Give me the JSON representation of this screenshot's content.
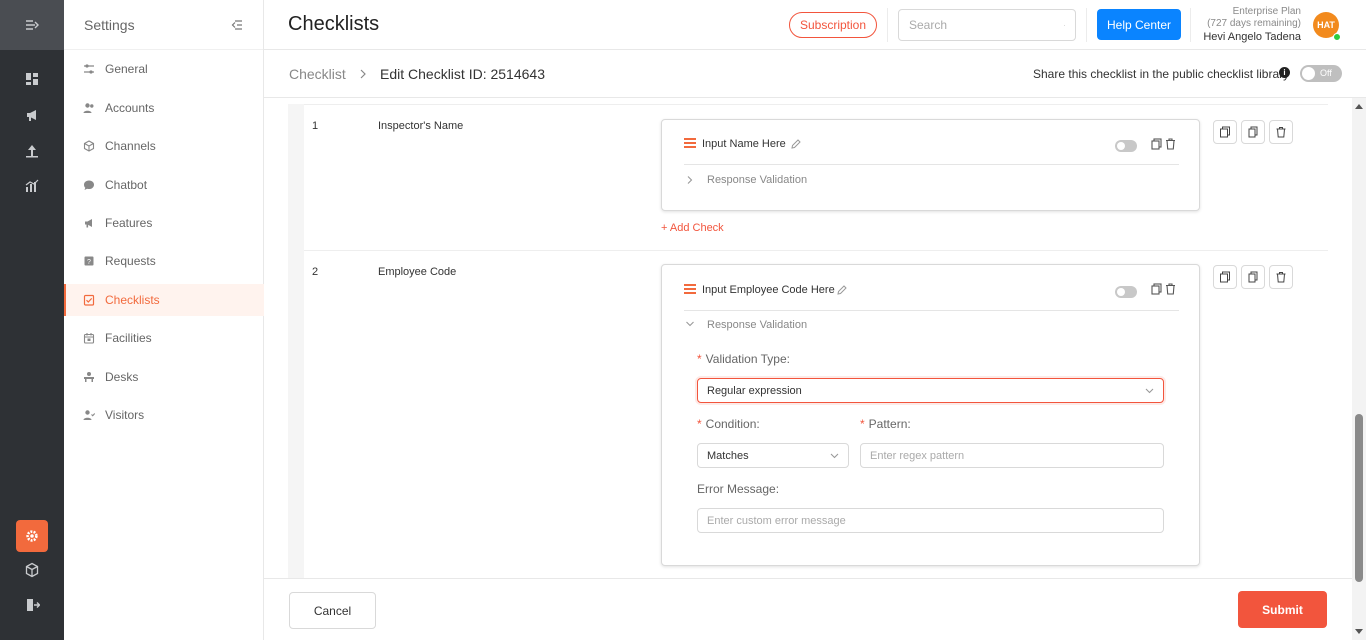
{
  "rail": {
    "icons": [
      "collapse-menu-icon",
      "dashboard-icon",
      "megaphone-icon",
      "analytics-icon",
      "bar-chart-icon",
      "settings-icon",
      "box-icon",
      "logout-icon"
    ],
    "active_color": "#f26a3d"
  },
  "sidebar": {
    "title": "Settings",
    "items": [
      {
        "label": "General",
        "icon": "sliders-icon"
      },
      {
        "label": "Accounts",
        "icon": "users-icon"
      },
      {
        "label": "Channels",
        "icon": "cube-icon"
      },
      {
        "label": "Chatbot",
        "icon": "chat-bubble-icon"
      },
      {
        "label": "Features",
        "icon": "megaphone-icon"
      },
      {
        "label": "Requests",
        "icon": "request-icon"
      },
      {
        "label": "Checklists",
        "icon": "checklist-icon",
        "active": true
      },
      {
        "label": "Facilities",
        "icon": "calendar-icon"
      },
      {
        "label": "Desks",
        "icon": "desk-icon"
      },
      {
        "label": "Visitors",
        "icon": "visitor-icon"
      }
    ]
  },
  "header": {
    "title": "Checklists",
    "subscription_label": "Subscription",
    "search_placeholder": "Search",
    "help_label": "Help Center",
    "plan_name": "Enterprise Plan",
    "plan_remaining": "(727 days remaining)",
    "user_name": "Hevi Angelo Tadena",
    "avatar_initials": "HAT"
  },
  "breadcrumb": {
    "root": "Checklist",
    "separator": ">",
    "current": "Edit Checklist ID: 2514643",
    "share_label": "Share this checklist in the public checklist library",
    "share_info": "i",
    "share_toggle": "Off"
  },
  "checklist": {
    "rows": [
      {
        "number": "1",
        "name": "Inspector's Name",
        "input_label": "Input Name Here",
        "response_validation": "Response Validation",
        "add_check": "+ Add Check"
      },
      {
        "number": "2",
        "name": "Employee Code",
        "input_label": "Input Employee Code Here",
        "response_validation": "Response Validation",
        "validation": {
          "type_label": "Validation Type:",
          "type_value": "Regular expression",
          "condition_label": "Condition:",
          "condition_value": "Matches",
          "pattern_label": "Pattern:",
          "pattern_placeholder": "Enter regex pattern",
          "error_label": "Error Message:",
          "error_placeholder": "Enter custom error message"
        }
      }
    ]
  },
  "footer": {
    "cancel_label": "Cancel",
    "submit_label": "Submit"
  },
  "colors": {
    "accent": "#f2553d",
    "primary_blue": "#0a84ff",
    "rail_bg": "#2e3135"
  }
}
